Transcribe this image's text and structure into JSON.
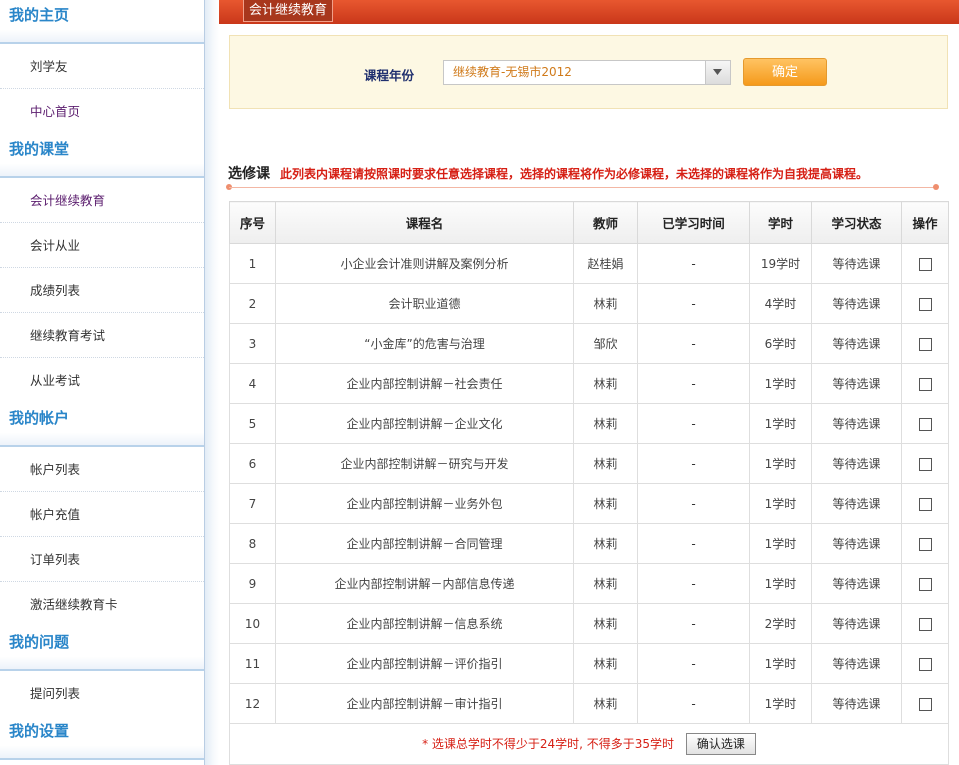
{
  "sidebar": {
    "sections": [
      {
        "title": "我的主页",
        "items": [
          "刘学友",
          "中心首页"
        ]
      },
      {
        "title": "我的课堂",
        "items": [
          "会计继续教育",
          "会计从业",
          "成绩列表",
          "继续教育考试",
          "从业考试"
        ]
      },
      {
        "title": "我的帐户",
        "items": [
          "帐户列表",
          "帐户充值",
          "订单列表",
          "激活继续教育卡"
        ]
      },
      {
        "title": "我的问题",
        "items": [
          "提问列表"
        ]
      },
      {
        "title": "我的设置",
        "items": []
      }
    ]
  },
  "header": {
    "tab": "会计继续教育"
  },
  "filter": {
    "label": "课程年份",
    "selected_year": "继续教育-无锡市2012",
    "confirm_label": "确定"
  },
  "elective": {
    "title": "选修课",
    "note": "此列表内课程请按照课时要求任意选择课程，选择的课程将作为必修课程，未选择的课程将作为自我提高课程。"
  },
  "table": {
    "headers": [
      "序号",
      "课程名",
      "教师",
      "已学习时间",
      "学时",
      "学习状态",
      "操作"
    ],
    "rows": [
      {
        "no": "1",
        "name": "小企业会计准则讲解及案例分析",
        "teacher": "赵桂娟",
        "studied": "-",
        "hours": "19学时",
        "status": "等待选课"
      },
      {
        "no": "2",
        "name": "会计职业道德",
        "teacher": "林莉",
        "studied": "-",
        "hours": "4学时",
        "status": "等待选课"
      },
      {
        "no": "3",
        "name": "“小金库”的危害与治理",
        "teacher": "邹欣",
        "studied": "-",
        "hours": "6学时",
        "status": "等待选课"
      },
      {
        "no": "4",
        "name": "企业内部控制讲解－社会责任",
        "teacher": "林莉",
        "studied": "-",
        "hours": "1学时",
        "status": "等待选课"
      },
      {
        "no": "5",
        "name": "企业内部控制讲解－企业文化",
        "teacher": "林莉",
        "studied": "-",
        "hours": "1学时",
        "status": "等待选课"
      },
      {
        "no": "6",
        "name": "企业内部控制讲解－研究与开发",
        "teacher": "林莉",
        "studied": "-",
        "hours": "1学时",
        "status": "等待选课"
      },
      {
        "no": "7",
        "name": "企业内部控制讲解－业务外包",
        "teacher": "林莉",
        "studied": "-",
        "hours": "1学时",
        "status": "等待选课"
      },
      {
        "no": "8",
        "name": "企业内部控制讲解－合同管理",
        "teacher": "林莉",
        "studied": "-",
        "hours": "1学时",
        "status": "等待选课"
      },
      {
        "no": "9",
        "name": "企业内部控制讲解－内部信息传递",
        "teacher": "林莉",
        "studied": "-",
        "hours": "1学时",
        "status": "等待选课"
      },
      {
        "no": "10",
        "name": "企业内部控制讲解－信息系统",
        "teacher": "林莉",
        "studied": "-",
        "hours": "2学时",
        "status": "等待选课"
      },
      {
        "no": "11",
        "name": "企业内部控制讲解－评价指引",
        "teacher": "林莉",
        "studied": "-",
        "hours": "1学时",
        "status": "等待选课"
      },
      {
        "no": "12",
        "name": "企业内部控制讲解－审计指引",
        "teacher": "林莉",
        "studied": "-",
        "hours": "1学时",
        "status": "等待选课"
      }
    ],
    "footer_note": "* 选课总学时不得少于24学时, 不得多于35学时",
    "submit_label": "确认选课"
  }
}
